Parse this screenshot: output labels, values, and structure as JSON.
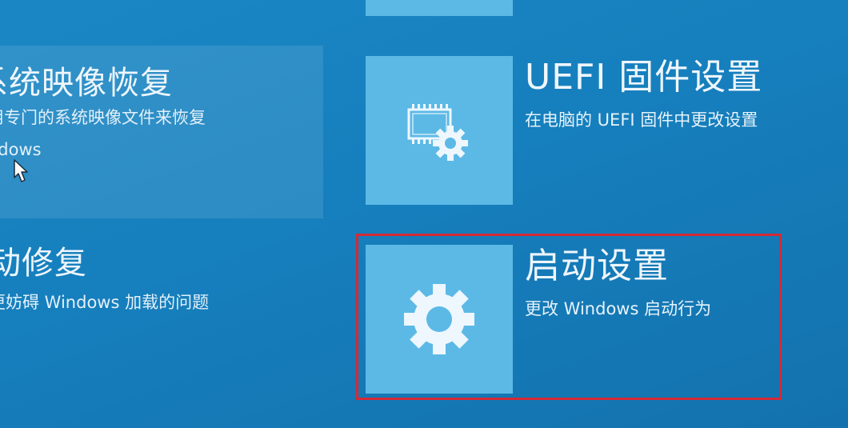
{
  "options": {
    "system_image_recovery": {
      "title": "系统映像恢复",
      "description": "用专门的系统映像文件来恢复 ndows"
    },
    "startup_repair": {
      "title": "动修复",
      "description": "更妨碍 Windows 加载的问题"
    },
    "uefi_firmware": {
      "title": "UEFI 固件设置",
      "description": "在电脑的 UEFI 固件中更改设置"
    },
    "startup_settings": {
      "title": "启动设置",
      "description": "更改 Windows 启动行为"
    }
  },
  "icons": {
    "uefi_tile": "chip-gear-icon",
    "startup_tile": "gear-icon",
    "cursor": "mouse-pointer-icon"
  },
  "colors": {
    "background": "#167fbd",
    "tile": "#5cb9e6",
    "selection_border": "#d42a36"
  }
}
